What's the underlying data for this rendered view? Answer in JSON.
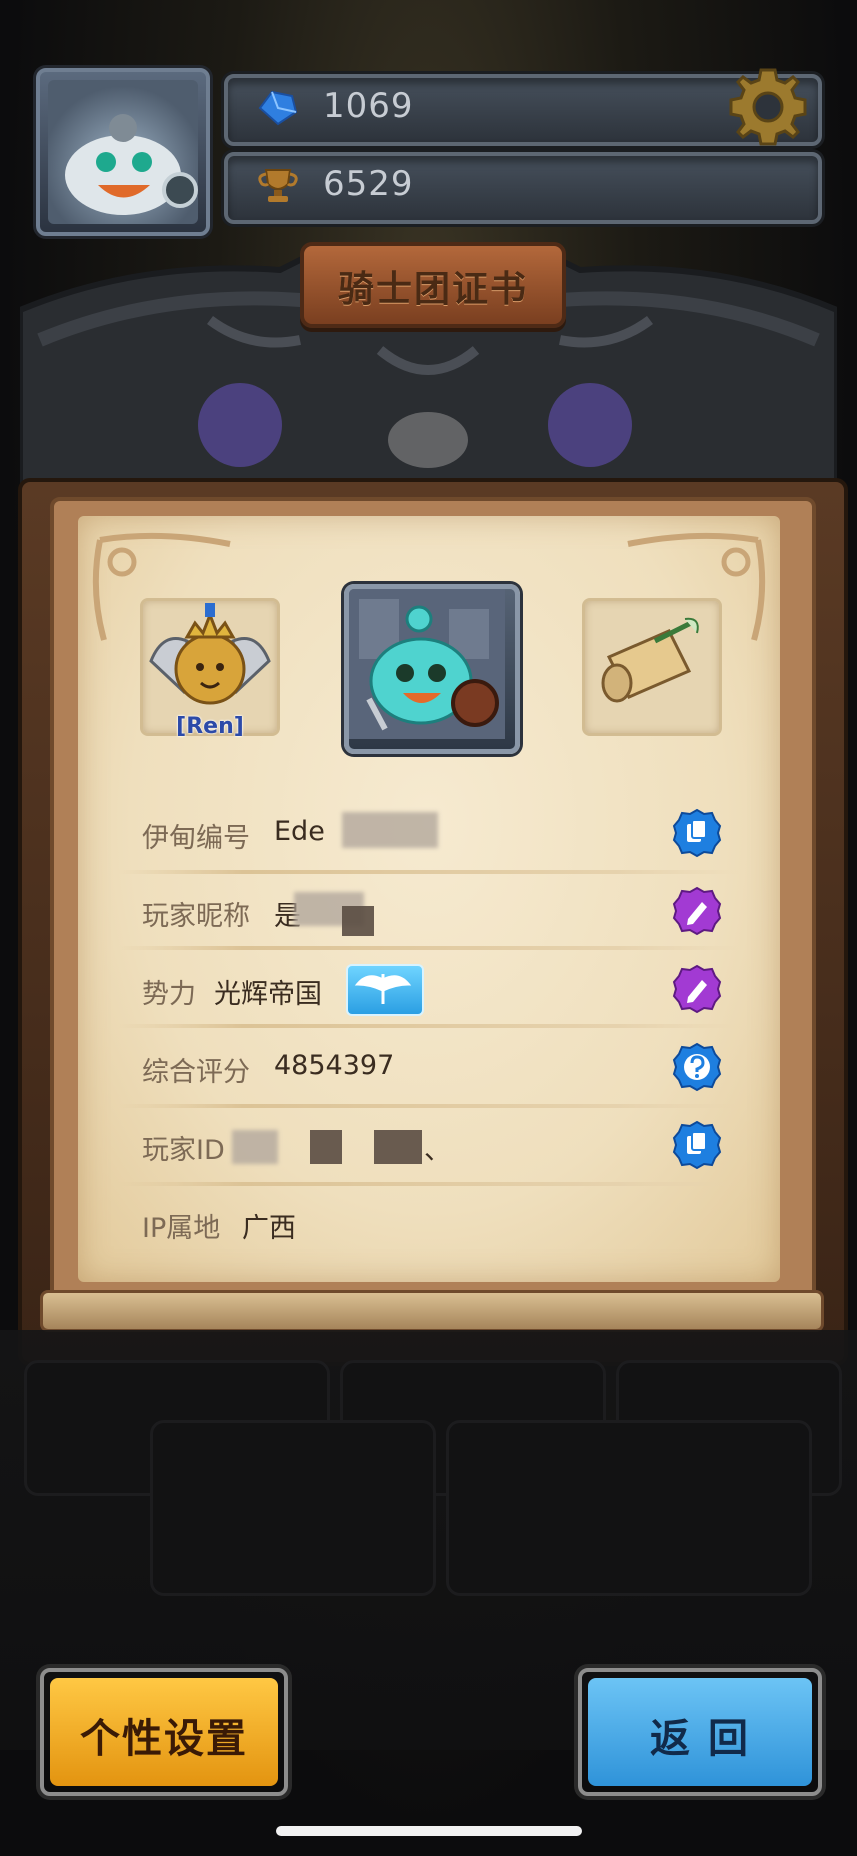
{
  "header": {
    "gems": "1069",
    "trophies": "6529",
    "gem_icon": "blue-gem-icon",
    "trophy_icon": "trophy-icon",
    "settings_icon": "gear-icon"
  },
  "title_sign": "骑士团证书",
  "card": {
    "left_badge_label": "[Ren]",
    "rows": [
      {
        "label": "伊甸编号",
        "value": "Ede",
        "action_icon": "copy-icon"
      },
      {
        "label": "玩家昵称",
        "value": "是",
        "action_icon": "edit-icon"
      },
      {
        "label": "势力",
        "value": "光辉帝国",
        "action_icon": "edit-icon"
      },
      {
        "label": "综合评分",
        "value": "4854397",
        "action_icon": "help-icon"
      },
      {
        "label": "玩家ID",
        "value": "、",
        "action_icon": "copy-icon"
      },
      {
        "label": "IP属地",
        "value": "广西"
      }
    ]
  },
  "buttons": {
    "personal_settings": "个性设置",
    "back": "返 回"
  },
  "colors": {
    "yellow_button": "#f2a81d",
    "blue_button": "#3aa6e8",
    "copy_badge": "#1e7fe0",
    "edit_badge": "#a23ad3"
  }
}
